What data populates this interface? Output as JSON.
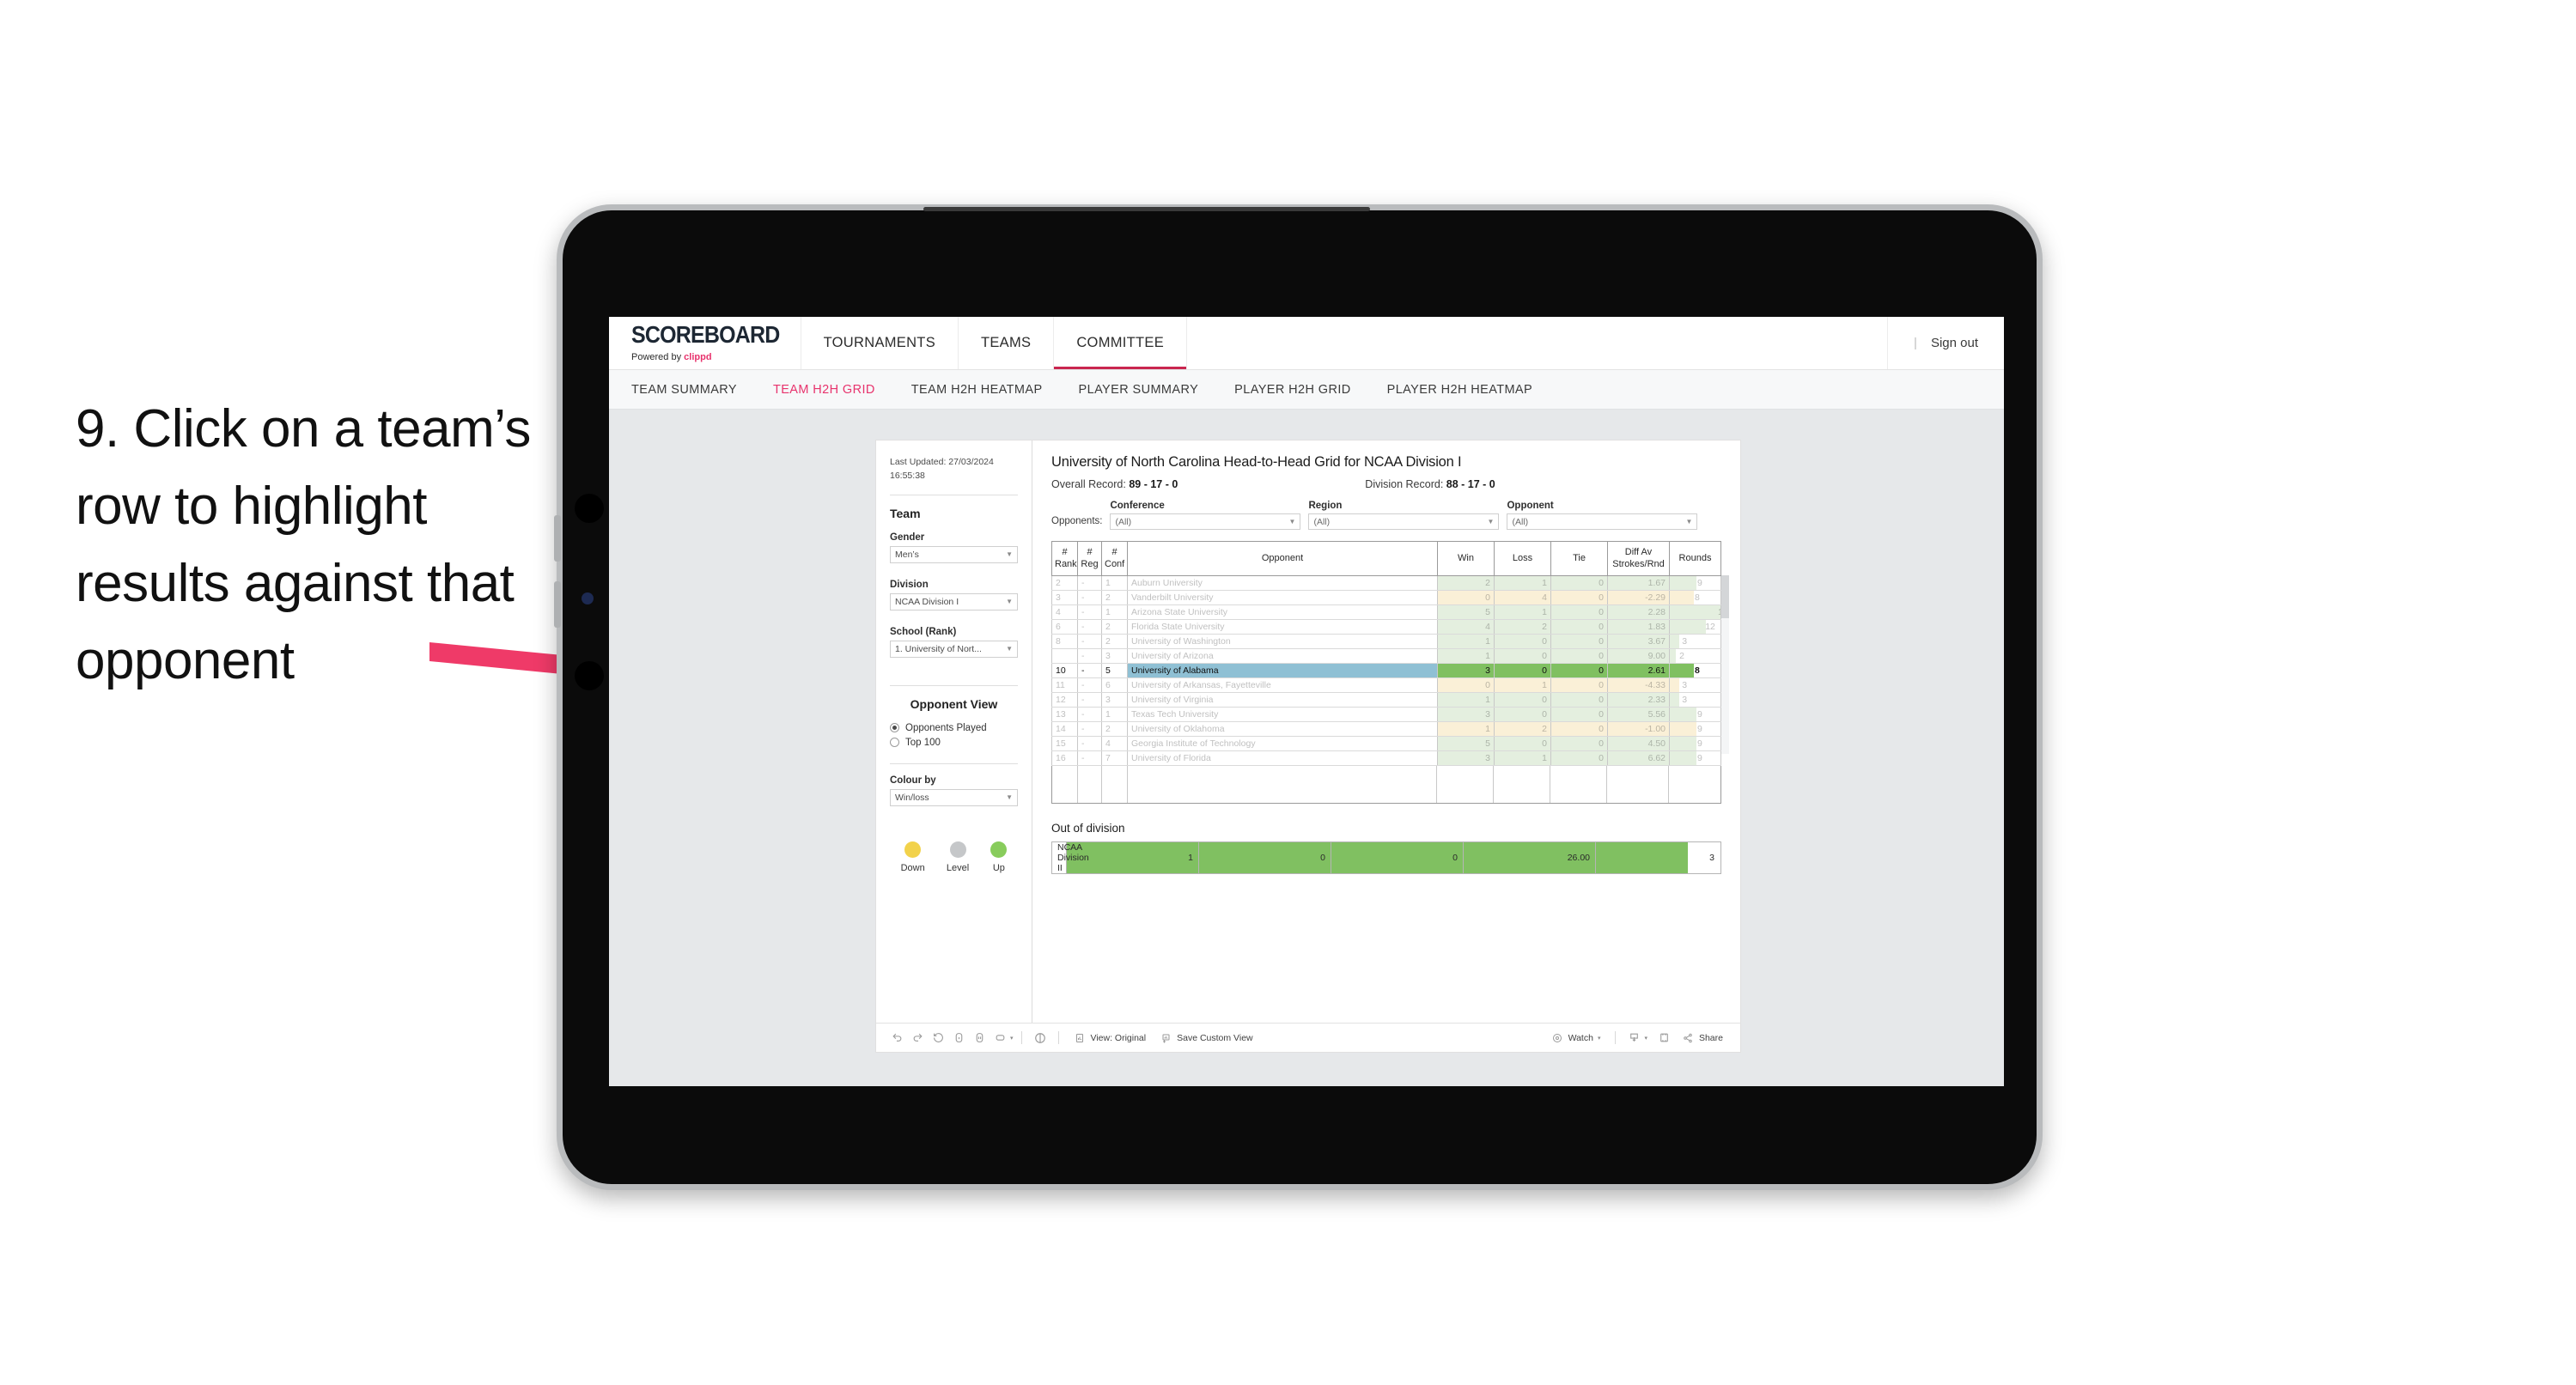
{
  "instruction": "9. Click on a team’s row to highlight results against that opponent",
  "topnav": {
    "brand_title": "SCOREBOARD",
    "brand_sub_prefix": "Powered by ",
    "brand_sub_name": "clippd",
    "items": [
      {
        "label": "TOURNAMENTS",
        "active": false
      },
      {
        "label": "TEAMS",
        "active": false
      },
      {
        "label": "COMMITTEE",
        "active": true
      }
    ],
    "divider": "|",
    "signout": "Sign out"
  },
  "subnav": {
    "items": [
      {
        "label": "TEAM SUMMARY",
        "active": false
      },
      {
        "label": "TEAM H2H GRID",
        "active": true
      },
      {
        "label": "TEAM H2H HEATMAP",
        "active": false
      },
      {
        "label": "PLAYER SUMMARY",
        "active": false
      },
      {
        "label": "PLAYER H2H GRID",
        "active": false
      },
      {
        "label": "PLAYER H2H HEATMAP",
        "active": false
      }
    ]
  },
  "sidebar": {
    "last_updated": "Last Updated: 27/03/2024 16:55:38",
    "team_heading": "Team",
    "gender_label": "Gender",
    "gender_value": "Men’s",
    "division_label": "Division",
    "division_value": "NCAA Division I",
    "school_label": "School (Rank)",
    "school_value": "1. University of Nort...",
    "opponent_view_heading": "Opponent View",
    "radio_opponents_played": "Opponents Played",
    "radio_top_100": "Top 100",
    "colour_by_label": "Colour by",
    "colour_by_value": "Win/loss",
    "legend": [
      {
        "label": "Down",
        "color": "#f2d24b"
      },
      {
        "label": "Level",
        "color": "#c5c7c9"
      },
      {
        "label": "Up",
        "color": "#88cc5c"
      }
    ]
  },
  "main": {
    "title": "University of North Carolina Head-to-Head Grid for NCAA Division I",
    "overall_record_label": "Overall Record: ",
    "overall_record_value": "89 - 17 - 0",
    "division_record_label": "Division Record: ",
    "division_record_value": "88 - 17 - 0",
    "opponents_label": "Opponents:",
    "filters": [
      {
        "label": "Conference",
        "value": "(All)"
      },
      {
        "label": "Region",
        "value": "(All)"
      },
      {
        "label": "Opponent",
        "value": "(All)"
      }
    ],
    "out_of_division_title": "Out of division",
    "out_of_division_row": {
      "label": "NCAA Division II",
      "win": "1",
      "loss": "0",
      "tie": "0",
      "diff": "26.00",
      "rounds": "3"
    }
  },
  "chart_data": {
    "type": "table",
    "title": "University of North Carolina Head-to-Head Grid for NCAA Division I",
    "columns": [
      "# Rank",
      "# Reg",
      "# Conf",
      "Opponent",
      "Win",
      "Loss",
      "Tie",
      "Diff Av Strokes/Rnd",
      "Rounds"
    ],
    "rounds_max": 17,
    "rows": [
      {
        "rank": "2",
        "reg": "-",
        "conf": "1",
        "opponent": "Auburn University",
        "win": "2",
        "loss": "1",
        "tie": "0",
        "diff": "1.67",
        "rounds": 9,
        "state": "up",
        "selected": false
      },
      {
        "rank": "3",
        "reg": "-",
        "conf": "2",
        "opponent": "Vanderbilt University",
        "win": "0",
        "loss": "4",
        "tie": "0",
        "diff": "-2.29",
        "rounds": 8,
        "state": "down",
        "selected": false
      },
      {
        "rank": "4",
        "reg": "-",
        "conf": "1",
        "opponent": "Arizona State University",
        "win": "5",
        "loss": "1",
        "tie": "0",
        "diff": "2.28",
        "rounds": 17,
        "state": "up",
        "selected": false
      },
      {
        "rank": "6",
        "reg": "-",
        "conf": "2",
        "opponent": "Florida State University",
        "win": "4",
        "loss": "2",
        "tie": "0",
        "diff": "1.83",
        "rounds": 12,
        "state": "up",
        "selected": false
      },
      {
        "rank": "8",
        "reg": "-",
        "conf": "2",
        "opponent": "University of Washington",
        "win": "1",
        "loss": "0",
        "tie": "0",
        "diff": "3.67",
        "rounds": 3,
        "state": "up",
        "selected": false
      },
      {
        "rank": "",
        "reg": "-",
        "conf": "3",
        "opponent": "University of Arizona",
        "win": "1",
        "loss": "0",
        "tie": "0",
        "diff": "9.00",
        "rounds": 2,
        "state": "up",
        "selected": false
      },
      {
        "rank": "10",
        "reg": "-",
        "conf": "5",
        "opponent": "University of Alabama",
        "win": "3",
        "loss": "0",
        "tie": "0",
        "diff": "2.61",
        "rounds": 8,
        "state": "up",
        "selected": true
      },
      {
        "rank": "11",
        "reg": "-",
        "conf": "6",
        "opponent": "University of Arkansas, Fayetteville",
        "win": "0",
        "loss": "1",
        "tie": "0",
        "diff": "-4.33",
        "rounds": 3,
        "state": "down",
        "selected": false
      },
      {
        "rank": "12",
        "reg": "-",
        "conf": "3",
        "opponent": "University of Virginia",
        "win": "1",
        "loss": "0",
        "tie": "0",
        "diff": "2.33",
        "rounds": 3,
        "state": "up",
        "selected": false
      },
      {
        "rank": "13",
        "reg": "-",
        "conf": "1",
        "opponent": "Texas Tech University",
        "win": "3",
        "loss": "0",
        "tie": "0",
        "diff": "5.56",
        "rounds": 9,
        "state": "up",
        "selected": false
      },
      {
        "rank": "14",
        "reg": "-",
        "conf": "2",
        "opponent": "University of Oklahoma",
        "win": "1",
        "loss": "2",
        "tie": "0",
        "diff": "-1.00",
        "rounds": 9,
        "state": "down",
        "selected": false
      },
      {
        "rank": "15",
        "reg": "-",
        "conf": "4",
        "opponent": "Georgia Institute of Technology",
        "win": "5",
        "loss": "0",
        "tie": "0",
        "diff": "4.50",
        "rounds": 9,
        "state": "up",
        "selected": false
      },
      {
        "rank": "16",
        "reg": "-",
        "conf": "7",
        "opponent": "University of Florida",
        "win": "3",
        "loss": "1",
        "tie": "0",
        "diff": "6.62",
        "rounds": 9,
        "state": "up",
        "selected": false
      }
    ]
  },
  "table_headers": {
    "rank_1": "#",
    "rank_2": "Rank",
    "reg_1": "#",
    "reg_2": "Reg",
    "conf_1": "#",
    "conf_2": "Conf",
    "opponent": "Opponent",
    "win": "Win",
    "loss": "Loss",
    "tie": "Tie",
    "diff_1": "Diff Av",
    "diff_2": "Strokes/Rnd",
    "rounds": "Rounds"
  },
  "toolbar": {
    "view_label": "View: Original",
    "save_label": "Save Custom View",
    "watch_label": "Watch",
    "share_label": "Share",
    "caret": "▾"
  },
  "colors": {
    "accent_pink": "#e8336d",
    "arrow": "#ef3a68",
    "selected_row": "#8fc0d4",
    "green": "#80c061",
    "up_bg": "#e4efdf",
    "down_bg": "#faf0d7"
  }
}
